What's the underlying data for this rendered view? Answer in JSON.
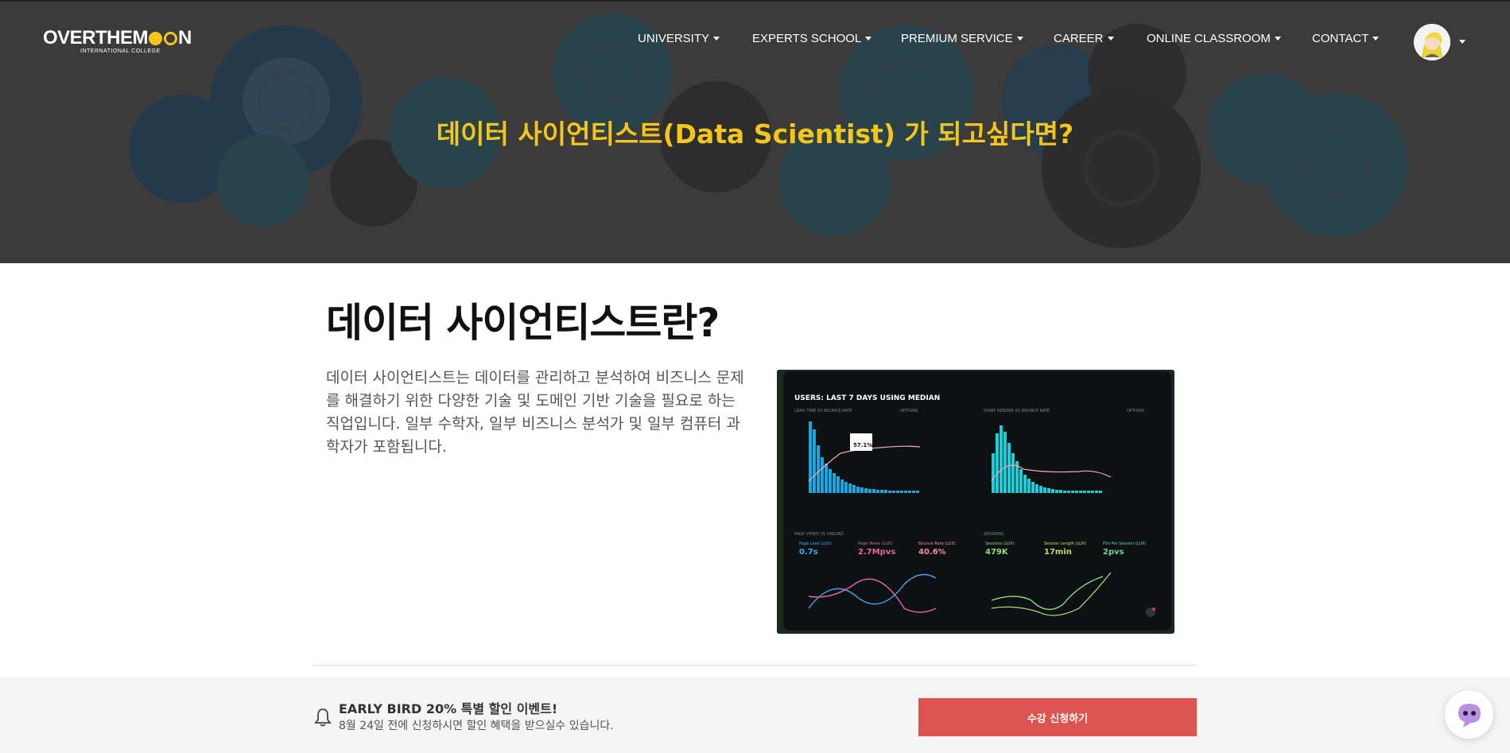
{
  "header": {
    "logo_main_part1": "OVERTHEM",
    "logo_main_part2": "N",
    "logo_sub": "INTERNATIONAL COLLEGE",
    "nav": [
      {
        "label": "UNIVERSITY"
      },
      {
        "label": "EXPERTS SCHOOL"
      },
      {
        "label": "PREMIUM SERVICE"
      },
      {
        "label": "CAREER"
      },
      {
        "label": "ONLINE CLASSROOM"
      },
      {
        "label": "CONTACT"
      }
    ]
  },
  "hero": {
    "title": "데이터 사이언티스트(Data Scientist) 가 되고싶다면?"
  },
  "section": {
    "title": "데이터 사이언티스트란?",
    "description": "데이터 사이언티스트는 데이터를 관리하고 분석하여 비즈니스 문제를 해결하기 위한 다양한 기술 및 도메인 기반 기술을 필요로 하는 직업입니다. 일부 수학자, 일부 비즈니스 분석가 및 일부 컴퓨터 과학자가 포함됩니다."
  },
  "dashboard": {
    "heading": "USERS: LAST 7 DAYS USING MEDIAN",
    "panel1_title": "LOAD TIME VS BOUNCE RATE",
    "panel2_title": "START RENDER VS BOUNCE RATE",
    "panel3_title": "PAGE VIEWS VS ONLOAD",
    "panel4_title": "SESSIONS",
    "options": "OPTIONS",
    "tooltip_value": "57.1%",
    "metrics": [
      {
        "label": "Page Load (LUX)",
        "value": "0.7s",
        "color": "#3fa9f5"
      },
      {
        "label": "Page Views (LUX)",
        "value": "2.7Mpvs",
        "color": "#e066a6"
      },
      {
        "label": "Bounce Rate (LUX)",
        "value": "40.6%",
        "color": "#f08fa0"
      },
      {
        "label": "Sessions (LUX)",
        "value": "479K",
        "color": "#8be07a"
      },
      {
        "label": "Session Length (LUX)",
        "value": "17min",
        "color": "#b8e06a"
      },
      {
        "label": "PVs Per Session (LUX)",
        "value": "2pvs",
        "color": "#6ad4a0"
      }
    ]
  },
  "promo": {
    "title": "EARLY BIRD 20% 특별 할인 이벤트!",
    "subtitle": "8월 24일 전에 신청하시면 할인 혜택을 받으실수 있습니다.",
    "button": "수강 신청하기"
  },
  "colors": {
    "accent_yellow": "#f5c518",
    "button_red": "#dc5350",
    "hero_bg": "#3b3b3b"
  }
}
